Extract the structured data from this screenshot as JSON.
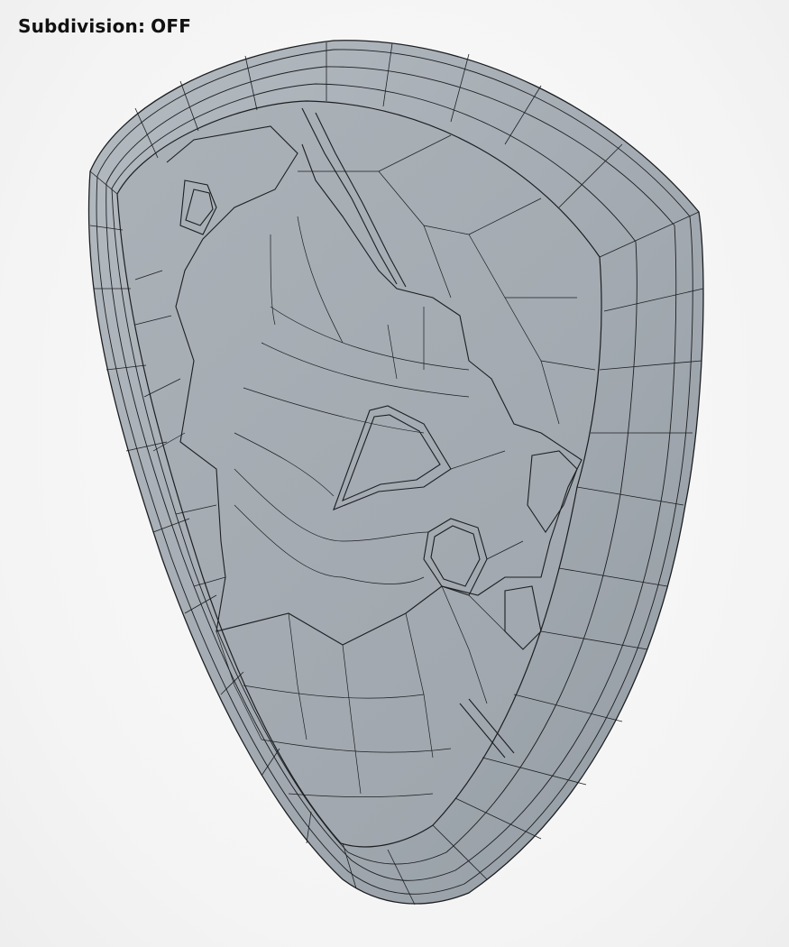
{
  "overlay": {
    "label": "Subdivision:",
    "value": "OFF"
  },
  "model": {
    "subject": "shield-mesh",
    "colors": {
      "surface": "#a6adb4",
      "surface_light": "#b9c0c6",
      "surface_dark": "#8b939b",
      "wire": "#1c1f22",
      "background": "#f6f6f6"
    }
  }
}
